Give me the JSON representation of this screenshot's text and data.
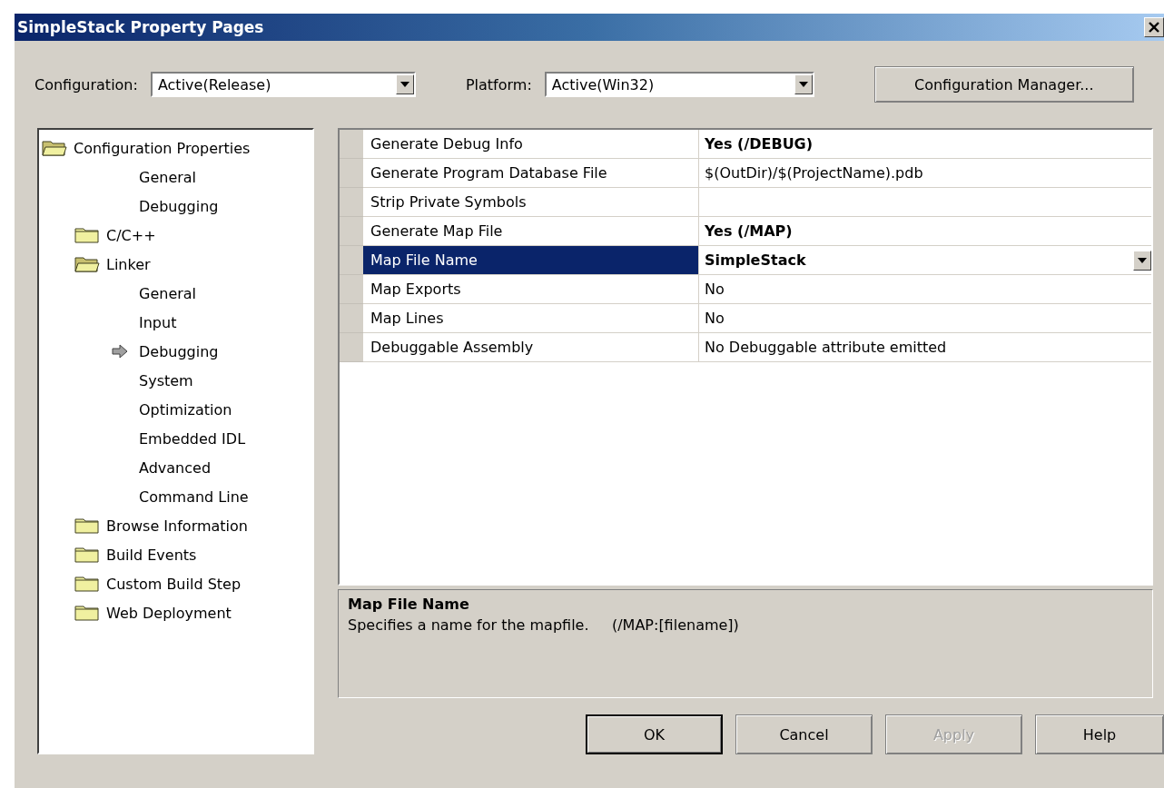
{
  "window": {
    "title": "SimpleStack Property Pages"
  },
  "configuration": {
    "label": "Configuration:",
    "value": "Active(Release)"
  },
  "platform": {
    "label": "Platform:",
    "value": "Active(Win32)"
  },
  "config_manager_button": "Configuration Manager...",
  "tree": [
    {
      "label": "Configuration Properties",
      "kind": "folder",
      "expanded": true,
      "selected": false,
      "children": [
        {
          "label": "General",
          "kind": "page",
          "selected": false
        },
        {
          "label": "Debugging",
          "kind": "page",
          "selected": false
        },
        {
          "label": "C/C++",
          "kind": "folder",
          "expanded": false,
          "selected": false
        },
        {
          "label": "Linker",
          "kind": "folder",
          "expanded": true,
          "selected": false,
          "children": [
            {
              "label": "General",
              "kind": "page",
              "selected": false
            },
            {
              "label": "Input",
              "kind": "page",
              "selected": false
            },
            {
              "label": "Debugging",
              "kind": "page",
              "selected": true
            },
            {
              "label": "System",
              "kind": "page",
              "selected": false
            },
            {
              "label": "Optimization",
              "kind": "page",
              "selected": false
            },
            {
              "label": "Embedded IDL",
              "kind": "page",
              "selected": false
            },
            {
              "label": "Advanced",
              "kind": "page",
              "selected": false
            },
            {
              "label": "Command Line",
              "kind": "page",
              "selected": false
            }
          ]
        },
        {
          "label": "Browse Information",
          "kind": "folder",
          "expanded": false,
          "selected": false
        },
        {
          "label": "Build Events",
          "kind": "folder",
          "expanded": false,
          "selected": false
        },
        {
          "label": "Custom Build Step",
          "kind": "folder",
          "expanded": false,
          "selected": false
        },
        {
          "label": "Web Deployment",
          "kind": "folder",
          "expanded": false,
          "selected": false
        }
      ]
    }
  ],
  "properties": [
    {
      "name": "Generate Debug Info",
      "value": "Yes (/DEBUG)",
      "modified": true,
      "selected": false
    },
    {
      "name": "Generate Program Database File",
      "value": "$(OutDir)/$(ProjectName).pdb",
      "modified": false,
      "selected": false
    },
    {
      "name": "Strip Private Symbols",
      "modified": false,
      "selected": false
    },
    {
      "name": "Generate Map File",
      "value": "Yes (/MAP)",
      "modified": true,
      "selected": false
    },
    {
      "name": "Map File Name",
      "value": "SimpleStack",
      "modified": true,
      "selected": true
    },
    {
      "name": "Map Exports",
      "value": "No",
      "modified": false,
      "selected": false
    },
    {
      "name": "Map Lines",
      "value": "No",
      "modified": false,
      "selected": false
    },
    {
      "name": "Debuggable Assembly",
      "value": "No Debuggable attribute emitted",
      "modified": false,
      "selected": false
    }
  ],
  "description": {
    "title": "Map File Name",
    "text": "Specifies a name for the mapfile.     (/MAP:[filename])"
  },
  "buttons": [
    {
      "label": "OK",
      "default": true,
      "disabled": false
    },
    {
      "label": "Cancel",
      "default": false,
      "disabled": false
    },
    {
      "label": "Apply",
      "default": false,
      "disabled": true
    },
    {
      "label": "Help",
      "default": false,
      "disabled": false
    }
  ]
}
